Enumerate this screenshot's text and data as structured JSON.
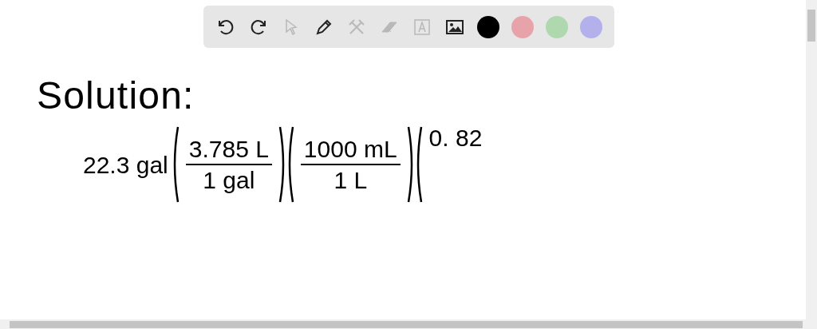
{
  "toolbar": {
    "tools": [
      {
        "kind": "undo",
        "disabled": false
      },
      {
        "kind": "redo",
        "disabled": false
      },
      {
        "kind": "select",
        "disabled": true
      },
      {
        "kind": "pen",
        "disabled": false
      },
      {
        "kind": "tools",
        "disabled": true
      },
      {
        "kind": "eraser",
        "disabled": true
      },
      {
        "kind": "text",
        "disabled": true
      },
      {
        "kind": "image",
        "disabled": false
      }
    ],
    "colors": [
      {
        "color": "#000000"
      },
      {
        "color": "#e8a3aa"
      },
      {
        "color": "#afd8ae"
      },
      {
        "color": "#b3b0ec"
      }
    ]
  },
  "board": {
    "heading": "Solution:",
    "expression": {
      "quantity": "22.3 gal",
      "factors": [
        {
          "numerator": "3.785 L",
          "denominator": "1 gal"
        },
        {
          "numerator": "1000 mL",
          "denominator": "1 L"
        }
      ],
      "partial": "0. 82"
    }
  }
}
